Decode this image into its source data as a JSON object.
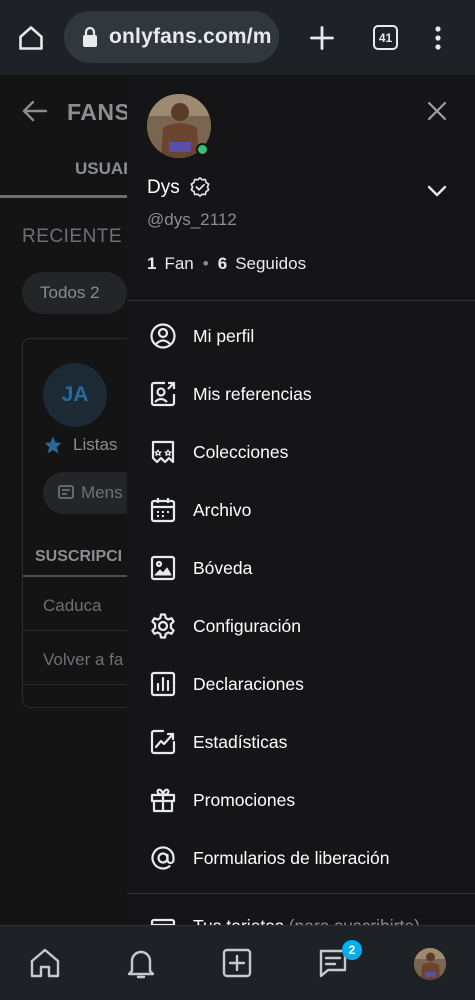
{
  "browser": {
    "url": "onlyfans.com/m",
    "tab_count": "41"
  },
  "background": {
    "title": "FANS",
    "tab": "USUAR",
    "section": "RECIENTE",
    "chip": "Todos 2",
    "card": {
      "avatar_initials": "JA",
      "lists_label": "Listas",
      "message_label": "Mens",
      "subscriptions_header": "SUSCRIPCI",
      "row1": "Caduca",
      "row2": "Volver a fa"
    }
  },
  "drawer": {
    "name": "Dys",
    "handle": "@dys_2112",
    "stats": {
      "fans_count": "1",
      "fans_label": "Fan",
      "following_count": "6",
      "following_label": "Seguidos"
    },
    "menu": [
      {
        "label": "Mi perfil",
        "icon": "profile-icon"
      },
      {
        "label": "Mis referencias",
        "icon": "referrals-icon"
      },
      {
        "label": "Colecciones",
        "icon": "collections-icon"
      },
      {
        "label": "Archivo",
        "icon": "calendar-icon"
      },
      {
        "label": "Bóveda",
        "icon": "vault-icon"
      },
      {
        "label": "Configuración",
        "icon": "gear-icon"
      },
      {
        "label": "Declaraciones",
        "icon": "statements-icon"
      },
      {
        "label": "Estadísticas",
        "icon": "statistics-icon"
      },
      {
        "label": "Promociones",
        "icon": "gift-icon"
      },
      {
        "label": "Formularios de liberación",
        "icon": "at-icon"
      }
    ],
    "partial_item": {
      "label": "Tus tarjetas",
      "suffix": "(para suscribirte)"
    }
  },
  "bottom_nav": {
    "messages_badge": "2"
  },
  "colors": {
    "accent": "#00aff0",
    "online": "#38c172",
    "drawer_bg": "#151517"
  }
}
